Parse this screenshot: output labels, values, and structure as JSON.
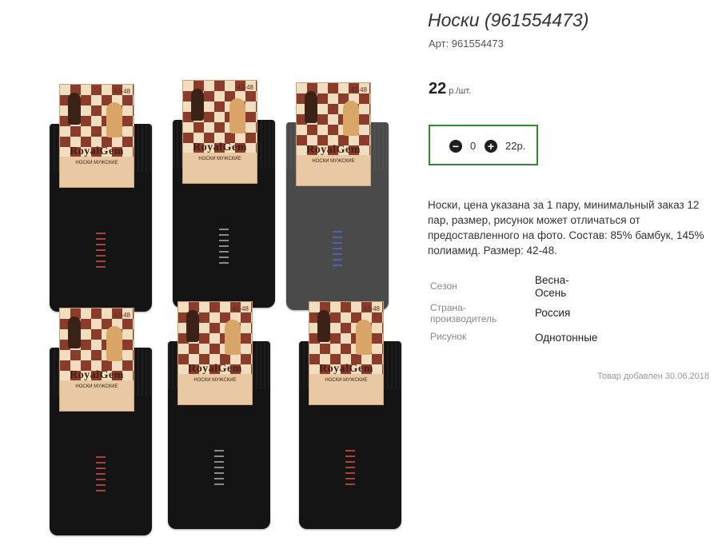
{
  "product": {
    "title": "Носки (961554473)",
    "sku_label": "Арт: 961554473",
    "price": "22",
    "price_unit": "р./шт.",
    "description": "Носки, цена указана за 1 пару, минимальный заказ 12 пар, размер, рисунок может отличаться от предоставленного на фото. Состав: 85% бамбук, 145% полиамид. Размер: 42-48.",
    "date_added": "Товар добавлен 30.06.2018"
  },
  "cart": {
    "quantity": "0",
    "total": "22р.",
    "border_color": "#2e8b2e"
  },
  "properties": [
    {
      "key": "Сезон",
      "value": "Весна-Осень"
    },
    {
      "key": "Страна-производитель",
      "value": "Россия"
    },
    {
      "key": "Рисунок",
      "value": "Однотонные"
    }
  ],
  "photo": {
    "brand": "RoyalGem",
    "label_sub": "НОСКИ МУЖСКИЕ",
    "size": "42-48",
    "icons": {
      "minus": "minus-circle-icon",
      "plus": "plus-circle-icon"
    }
  }
}
